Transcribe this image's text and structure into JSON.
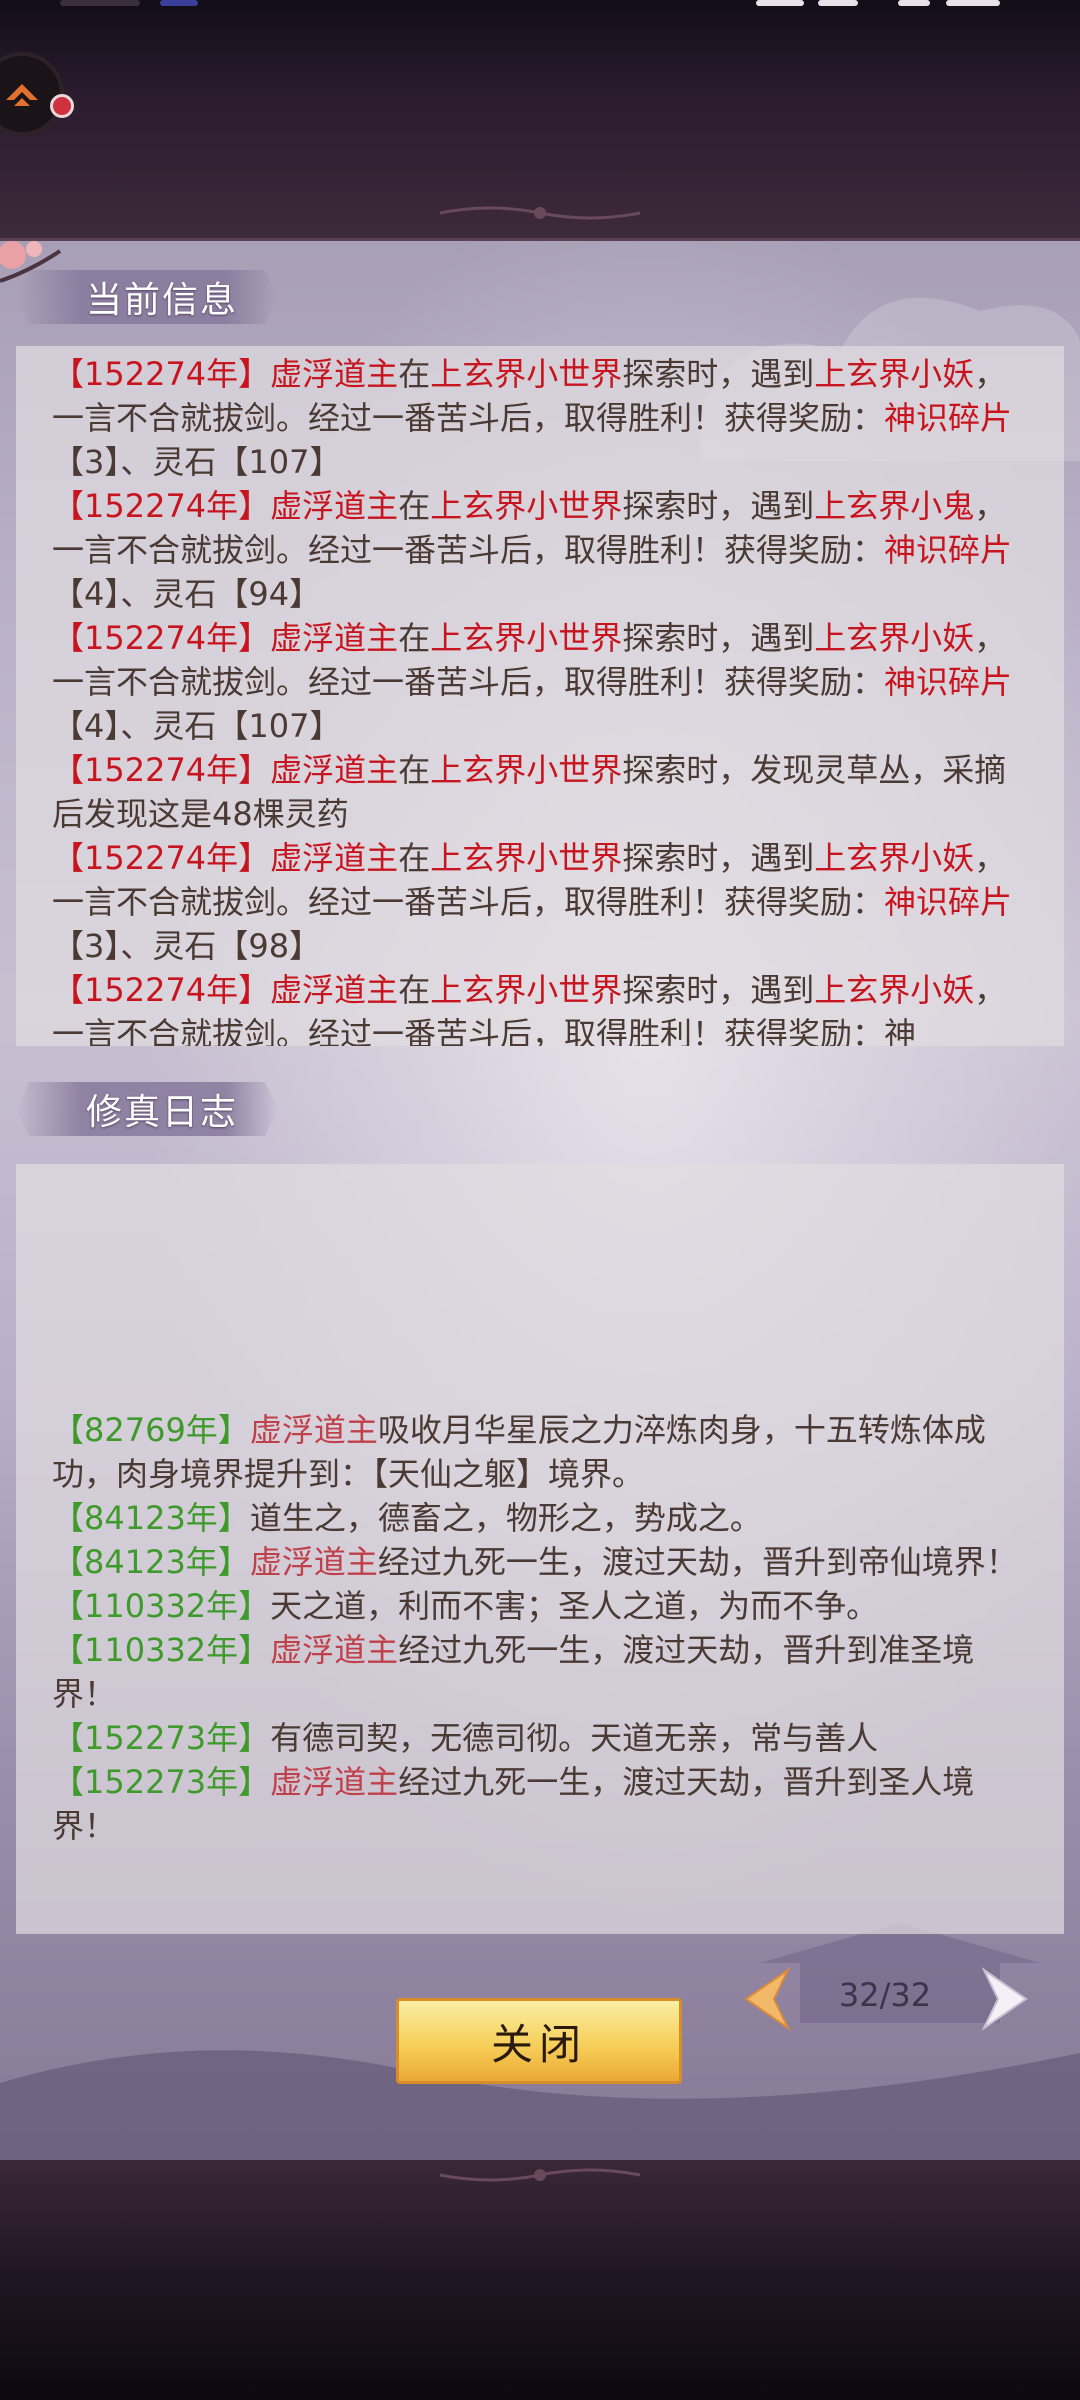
{
  "sections": {
    "current": {
      "title": "当前信息",
      "entries": [
        {
          "year": "【152274年】",
          "actor": "虚浮道主",
          "t1": "在",
          "place": "上玄界小世界",
          "t2": "探索时，遇到",
          "enemy": "上玄界小妖",
          "t3": "，一言不合就拔剑。经过一番苦斗后，取得胜利！获得奖励：",
          "item": "神识碎片",
          "qty": "【3】",
          "t4": "、灵石【107】"
        },
        {
          "year": "【152274年】",
          "actor": "虚浮道主",
          "t1": "在",
          "place": "上玄界小世界",
          "t2": "探索时，遇到",
          "enemy": "上玄界小鬼",
          "t3": "，一言不合就拔剑。经过一番苦斗后，取得胜利！获得奖励：",
          "item": "神识碎片",
          "qty": "【4】",
          "t4": "、灵石【94】"
        },
        {
          "year": "【152274年】",
          "actor": "虚浮道主",
          "t1": "在",
          "place": "上玄界小世界",
          "t2": "探索时，遇到",
          "enemy": "上玄界小妖",
          "t3": "，一言不合就拔剑。经过一番苦斗后，取得胜利！获得奖励：",
          "item": "神识碎片",
          "qty": "【4】",
          "t4": "、灵石【107】"
        },
        {
          "year": "【152274年】",
          "actor": "虚浮道主",
          "t1": "在",
          "place": "上玄界小世界",
          "t2": "探索时，发现灵草丛，采摘后发现这是48棵灵药"
        },
        {
          "year": "【152274年】",
          "actor": "虚浮道主",
          "t1": "在",
          "place": "上玄界小世界",
          "t2": "探索时，遇到",
          "enemy": "上玄界小妖",
          "t3": "，一言不合就拔剑。经过一番苦斗后，取得胜利！获得奖励：",
          "item": "神识碎片",
          "qty": "【3】",
          "t4": "、灵石【98】"
        },
        {
          "year": "【152274年】",
          "actor": "虚浮道主",
          "t1": "在",
          "place": "上玄界小世界",
          "t2": "探索时，遇到",
          "enemy": "上玄界小妖",
          "t3": "，一言不合就拔剑。经过一番苦斗后，取得胜利！获得奖励：神"
        }
      ]
    },
    "journal": {
      "title": "修真日志",
      "entries": [
        {
          "year": "【82769年】",
          "actor": "虚浮道主",
          "text": "吸收月华星辰之力淬炼肉身，十五转炼体成功，肉身境界提升到：【天仙之躯】境界。"
        },
        {
          "year": "【84123年】",
          "text": "道生之，德畜之，物形之，势成之。"
        },
        {
          "year": "【84123年】",
          "actor": "虚浮道主",
          "text": "经过九死一生，渡过天劫，晋升到帝仙境界！"
        },
        {
          "year": "【110332年】",
          "text": "天之道，利而不害；圣人之道，为而不争。"
        },
        {
          "year": "【110332年】",
          "actor": "虚浮道主",
          "text": "经过九死一生，渡过天劫，晋升到准圣境界！"
        },
        {
          "year": "【152273年】",
          "text": "有德司契，无德司彻。天道无亲，常与善人"
        },
        {
          "year": "【152273年】",
          "actor": "虚浮道主",
          "text": "经过九死一生，渡过天劫，晋升到圣人境界！"
        }
      ]
    }
  },
  "controls": {
    "close_label": "关闭",
    "page": "32/32"
  },
  "colors": {
    "highlight_red": "#c8141e",
    "year_green": "#3f9a2c",
    "body_text": "#4b3a33",
    "button_gold": "#f6cf5a"
  },
  "icons": [
    "app-logo-icon",
    "notification-dot",
    "prev-arrow-icon",
    "next-arrow-icon"
  ]
}
